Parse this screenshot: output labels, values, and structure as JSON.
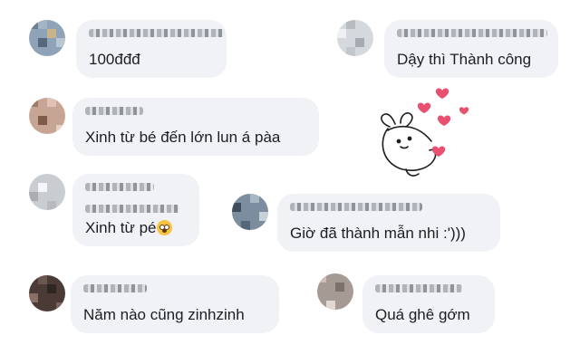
{
  "comments": [
    {
      "text": "100đđđ"
    },
    {
      "text": "Dậy thì Thành công"
    },
    {
      "text": "Xinh từ bé đến lớn lun á pàa"
    },
    {
      "text": "Xinh từ pé",
      "emoji": "flushed-face-emoji"
    },
    {
      "text": "Giờ đã thành mẫn nhi :')))"
    },
    {
      "text": "Năm nào cũng zinhzinh"
    },
    {
      "text": "Quá ghê gớm"
    }
  ],
  "sticker": {
    "name": "bunny-hearts-sticker",
    "heart_color": "#e8506e"
  },
  "colors": {
    "bubble": "#f0f2f5",
    "text": "#1c1e21"
  }
}
